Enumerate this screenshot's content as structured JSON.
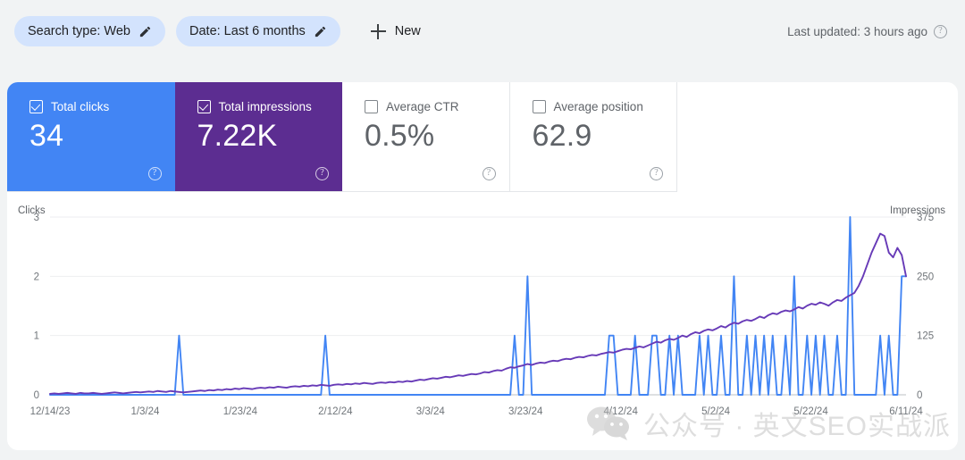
{
  "filters": {
    "search_type_chip": "Search type: Web",
    "date_chip": "Date: Last 6 months",
    "new_button": "New",
    "last_updated": "Last updated: 3 hours ago"
  },
  "metrics": [
    {
      "label": "Total clicks",
      "value": "34",
      "checked": true,
      "style": "blue"
    },
    {
      "label": "Total impressions",
      "value": "7.22K",
      "checked": true,
      "style": "purple"
    },
    {
      "label": "Average CTR",
      "value": "0.5%",
      "checked": false,
      "style": "plain"
    },
    {
      "label": "Average position",
      "value": "62.9",
      "checked": false,
      "style": "plain"
    }
  ],
  "watermark": {
    "text": "公众号 · 英文SEO实战派"
  },
  "colors": {
    "clicks": "#4285F4",
    "impressions": "#673AB7",
    "clicks_card": "#4285F4",
    "impressions_card": "#5C2D91",
    "chip_bg": "#D3E3FD",
    "page_bg": "#F1F3F4"
  },
  "chart_data": {
    "type": "line",
    "title": "",
    "grid": true,
    "legend": "none",
    "xlabel": "",
    "x_tick_labels": [
      "12/14/23",
      "1/3/24",
      "1/23/24",
      "2/12/24",
      "3/3/24",
      "3/23/24",
      "4/12/24",
      "5/2/24",
      "5/22/24",
      "6/11/24"
    ],
    "axes": [
      {
        "name": "Clicks",
        "side": "left",
        "ylabel": "Clicks",
        "ticks": [
          0,
          1,
          2,
          3
        ],
        "ylim": [
          0,
          3
        ]
      },
      {
        "name": "Impressions",
        "side": "right",
        "ylabel": "Impressions",
        "ticks": [
          0,
          125,
          250,
          375
        ],
        "ylim": [
          0,
          375
        ]
      }
    ],
    "series": [
      {
        "name": "Clicks",
        "axis": "left",
        "color": "#4285F4",
        "values": [
          0,
          0,
          0,
          0,
          0,
          0,
          0,
          0,
          0,
          0,
          0,
          0,
          0,
          0,
          0,
          0,
          0,
          0,
          0,
          0,
          0,
          0,
          0,
          0,
          0,
          0,
          0,
          0,
          0,
          0,
          1,
          0,
          0,
          0,
          0,
          0,
          0,
          0,
          0,
          0,
          0,
          0,
          0,
          0,
          0,
          0,
          0,
          0,
          0,
          0,
          0,
          0,
          0,
          0,
          0,
          0,
          0,
          0,
          0,
          0,
          0,
          0,
          0,
          0,
          1,
          0,
          0,
          0,
          0,
          0,
          0,
          0,
          0,
          0,
          0,
          0,
          0,
          0,
          0,
          0,
          0,
          0,
          0,
          0,
          0,
          0,
          0,
          0,
          0,
          0,
          0,
          0,
          0,
          0,
          0,
          0,
          0,
          0,
          0,
          0,
          0,
          0,
          0,
          0,
          0,
          0,
          0,
          0,
          1,
          0,
          0,
          2,
          0,
          0,
          0,
          0,
          0,
          0,
          0,
          0,
          0,
          0,
          0,
          0,
          0,
          0,
          0,
          0,
          0,
          0,
          1,
          1,
          0,
          0,
          0,
          0,
          1,
          0,
          0,
          0,
          1,
          1,
          0,
          0,
          1,
          0,
          1,
          0,
          0,
          0,
          0,
          1,
          0,
          1,
          0,
          0,
          1,
          0,
          0,
          2,
          0,
          0,
          1,
          0,
          1,
          0,
          1,
          0,
          1,
          0,
          0,
          1,
          0,
          2,
          0,
          0,
          1,
          0,
          1,
          0,
          1,
          0,
          0,
          1,
          0,
          0,
          3,
          0,
          0,
          0,
          0,
          0,
          0,
          1,
          0,
          1,
          0,
          0,
          2,
          2
        ]
      },
      {
        "name": "Impressions",
        "axis": "right",
        "color": "#673AB7",
        "values": [
          2,
          3,
          2,
          3,
          4,
          3,
          2,
          4,
          3,
          3,
          4,
          3,
          2,
          3,
          4,
          5,
          4,
          3,
          4,
          5,
          6,
          5,
          6,
          7,
          6,
          8,
          7,
          6,
          8,
          7,
          6,
          5,
          6,
          7,
          8,
          9,
          8,
          10,
          9,
          11,
          10,
          12,
          11,
          13,
          12,
          14,
          13,
          12,
          14,
          15,
          14,
          16,
          15,
          17,
          16,
          15,
          17,
          18,
          17,
          19,
          18,
          20,
          19,
          21,
          20,
          19,
          21,
          22,
          21,
          23,
          22,
          24,
          23,
          25,
          24,
          23,
          25,
          26,
          25,
          27,
          26,
          28,
          27,
          29,
          28,
          30,
          32,
          31,
          33,
          35,
          34,
          36,
          38,
          37,
          39,
          41,
          40,
          42,
          44,
          43,
          45,
          48,
          47,
          50,
          52,
          51,
          55,
          58,
          57,
          60,
          62,
          65,
          63,
          66,
          68,
          67,
          70,
          72,
          71,
          74,
          76,
          75,
          78,
          80,
          79,
          82,
          84,
          83,
          86,
          88,
          90,
          89,
          92,
          95,
          97,
          96,
          99,
          102,
          100,
          104,
          108,
          112,
          110,
          115,
          118,
          116,
          120,
          125,
          122,
          128,
          132,
          130,
          135,
          138,
          136,
          140,
          145,
          142,
          148,
          152,
          150,
          155,
          158,
          156,
          160,
          165,
          162,
          168,
          172,
          170,
          175,
          178,
          176,
          180,
          185,
          182,
          188,
          192,
          190,
          195,
          192,
          188,
          195,
          200,
          198,
          205,
          210,
          215,
          230,
          250,
          275,
          300,
          320,
          340,
          335,
          300,
          290,
          310,
          295,
          250
        ]
      }
    ]
  }
}
